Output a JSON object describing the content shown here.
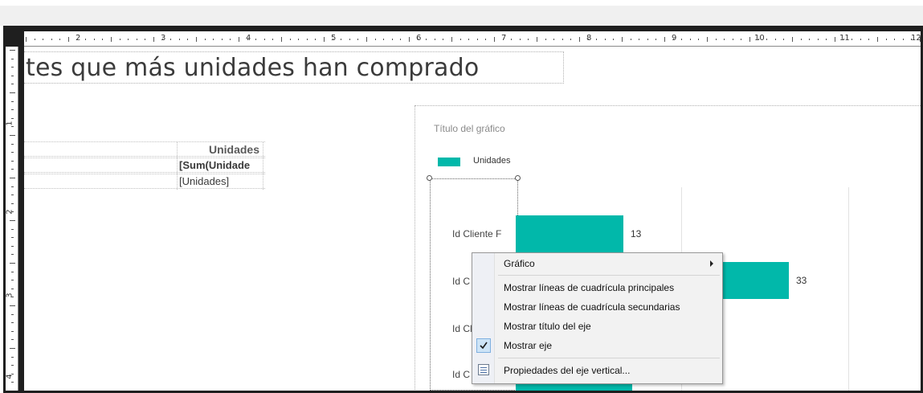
{
  "ruler": {
    "h_numbers": [
      "2",
      "3",
      "4",
      "5",
      "6",
      "7",
      "8",
      "9",
      "10",
      "11",
      "12"
    ],
    "v_numbers": [
      "1",
      "2",
      "3",
      "4"
    ]
  },
  "report": {
    "title": "tes que más unidades han comprado"
  },
  "table": {
    "header": "Unidades",
    "group_expr": "[Sum(Unidade",
    "detail_expr": "[Unidades]"
  },
  "chart_data": {
    "type": "bar",
    "title": "Título del gráfico",
    "legend": "Unidades",
    "categories": [
      "Id Cliente F",
      "Id C",
      "Id Cl",
      "Id C"
    ],
    "series": [
      {
        "name": "Unidades",
        "values": [
          13,
          33,
          null,
          null
        ],
        "color": "#01b8aa"
      }
    ],
    "data_labels": [
      "13",
      "33"
    ]
  },
  "context_menu": {
    "items": [
      {
        "label": "Gráfico",
        "submenu": true
      },
      {
        "label": "Mostrar líneas de cuadrícula principales"
      },
      {
        "label": "Mostrar líneas de cuadrícula secundarias"
      },
      {
        "label": "Mostrar título del eje"
      },
      {
        "label": "Mostrar eje",
        "checked": true
      },
      {
        "label": "Propiedades del eje vertical...",
        "icon": "properties-icon"
      }
    ]
  }
}
